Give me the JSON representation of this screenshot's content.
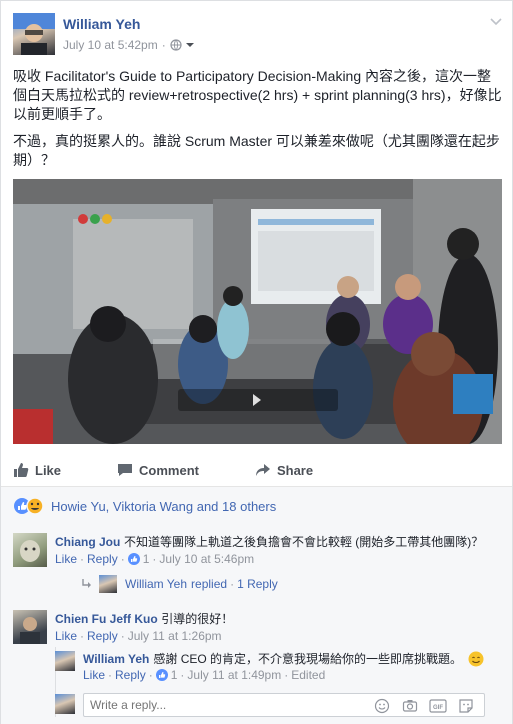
{
  "post": {
    "author": "William Yeh",
    "timestamp": "July 10 at 5:42pm",
    "separator": "·",
    "paragraph1": "吸收 Facilitator's Guide to Participatory Decision-Making 內容之後，這次一整個白天馬拉松式的 review+retrospective(2 hrs) + sprint planning(3 hrs)，好像比以前更順手了。",
    "paragraph2": "不過，真的挺累人的。誰說 Scrum Master 可以兼差來做呢（尤其團隊還在起步期）？"
  },
  "actions": {
    "like": "Like",
    "comment": "Comment",
    "share": "Share"
  },
  "reactions": {
    "summary": "Howie Yu, Viktoria Wang and 18 others"
  },
  "comments": [
    {
      "author": "Chiang Jou",
      "text": "不知道等團隊上軌道之後負擔會不會比較輕 (開始多工帶其他團隊)？",
      "like": "Like",
      "reply": "Reply",
      "like_count": "1",
      "time": "July 10 at 5:46pm",
      "replied_summary_author": "William Yeh",
      "replied_summary_text": "replied",
      "replied_count": "1 Reply"
    },
    {
      "author": "Chien Fu Jeff Kuo",
      "text": "引導的很好！",
      "like": "Like",
      "reply": "Reply",
      "time": "July 11 at 1:26pm"
    }
  ],
  "reply": {
    "author": "William Yeh",
    "text": "感謝 CEO 的肯定，不介意我現場給你的一些即席挑戰題。",
    "like": "Like",
    "reply": "Reply",
    "like_count": "1",
    "time": "July 11 at 1:49pm",
    "edited": "Edited"
  },
  "composer": {
    "placeholder": "Write a reply..."
  },
  "colors": {
    "link": "#365899",
    "like_blue": "#4267b2",
    "muted": "#90949c"
  }
}
